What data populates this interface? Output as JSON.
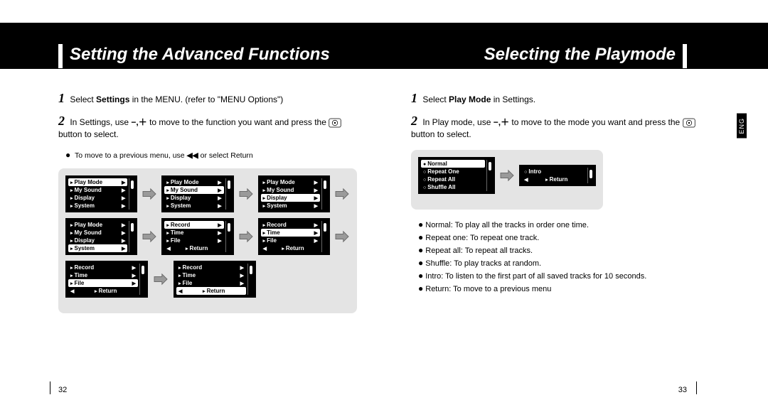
{
  "header": {
    "left_title": "Setting the Advanced Functions",
    "right_title": "Selecting the Playmode",
    "lang_tab": "ENG"
  },
  "left_page": {
    "number": "32",
    "steps": {
      "s1_pre": "Select ",
      "s1_bold": "Settings",
      "s1_post": " in the MENU. (refer to \"MENU Options\")",
      "s2_pre": "In Settings, use ",
      "s2_mid": " to move to the function you want and press the ",
      "s2_post": " button to select.",
      "note_pre": "To move to a previous menu, use ",
      "note_post": " or select Return"
    },
    "icons": {
      "minus_plus": "−,＋",
      "rewind": "◀◀"
    },
    "diagrams": {
      "groupA": [
        {
          "items": [
            {
              "t": "Play Mode",
              "sel": true,
              "arr": "r"
            },
            {
              "t": "My Sound",
              "arr": "r"
            },
            {
              "t": "Display",
              "arr": "r"
            },
            {
              "t": "System",
              "arr": "r"
            }
          ]
        },
        {
          "items": [
            {
              "t": "Play Mode",
              "arr": "r"
            },
            {
              "t": "My Sound",
              "sel": true,
              "arr": "r"
            },
            {
              "t": "Display",
              "arr": "r"
            },
            {
              "t": "System",
              "arr": "r"
            }
          ]
        },
        {
          "items": [
            {
              "t": "Play Mode",
              "arr": "r"
            },
            {
              "t": "My Sound",
              "arr": "r"
            },
            {
              "t": "Display",
              "sel": true,
              "arr": "r"
            },
            {
              "t": "System",
              "arr": "r"
            }
          ]
        }
      ],
      "groupB": [
        {
          "items": [
            {
              "t": "Play Mode",
              "arr": "r"
            },
            {
              "t": "My Sound",
              "arr": "r"
            },
            {
              "t": "Display",
              "arr": "r"
            },
            {
              "t": "System",
              "sel": true,
              "arr": "r"
            }
          ]
        },
        {
          "items": [
            {
              "t": "Record",
              "sel": true,
              "arr": "r"
            },
            {
              "t": "Time",
              "arr": "r"
            },
            {
              "t": "File",
              "arr": "r"
            },
            {
              "t": "Return",
              "arr": "l"
            }
          ]
        },
        {
          "items": [
            {
              "t": "Record",
              "arr": "r"
            },
            {
              "t": "Time",
              "sel": true,
              "arr": "r"
            },
            {
              "t": "File",
              "arr": "r"
            },
            {
              "t": "Return",
              "arr": "l"
            }
          ]
        }
      ],
      "groupC": [
        {
          "items": [
            {
              "t": "Record",
              "arr": "r"
            },
            {
              "t": "Time",
              "arr": "r"
            },
            {
              "t": "File",
              "sel": true,
              "arr": "r"
            },
            {
              "t": "Return",
              "arr": "l"
            }
          ]
        },
        {
          "items": [
            {
              "t": "Record",
              "arr": "r"
            },
            {
              "t": "Time",
              "arr": "r"
            },
            {
              "t": "File",
              "arr": "r"
            },
            {
              "t": "Return",
              "sel": true,
              "arr": "l"
            }
          ]
        }
      ]
    }
  },
  "right_page": {
    "number": "33",
    "steps": {
      "s1_pre": "Select ",
      "s1_bold": "Play Mode",
      "s1_post": " in Settings.",
      "s2_pre": "In Play mode, use ",
      "s2_mid": " to move to the mode you want and press the ",
      "s2_post": " button to select."
    },
    "diagrams": {
      "pair": [
        {
          "items": [
            {
              "t": "Normal",
              "sel": true,
              "mark": "of"
            },
            {
              "t": "Repeat One",
              "mark": "o"
            },
            {
              "t": "Repeat All",
              "mark": "o"
            },
            {
              "t": "Shuffle All",
              "mark": "o"
            }
          ]
        },
        {
          "items": [
            {
              "t": "Intro",
              "mark": "o"
            },
            {
              "t": "Return",
              "arr": "l"
            }
          ]
        }
      ]
    },
    "bullets": [
      "Normal: To play all the tracks in order one time.",
      "Repeat one: To repeat one track.",
      "Repeat all: To repeat all tracks.",
      "Shuffle: To play tracks at random.",
      "Intro: To listen to the first part of all saved tracks for 10 seconds.",
      "Return: To move to a previous menu"
    ]
  }
}
